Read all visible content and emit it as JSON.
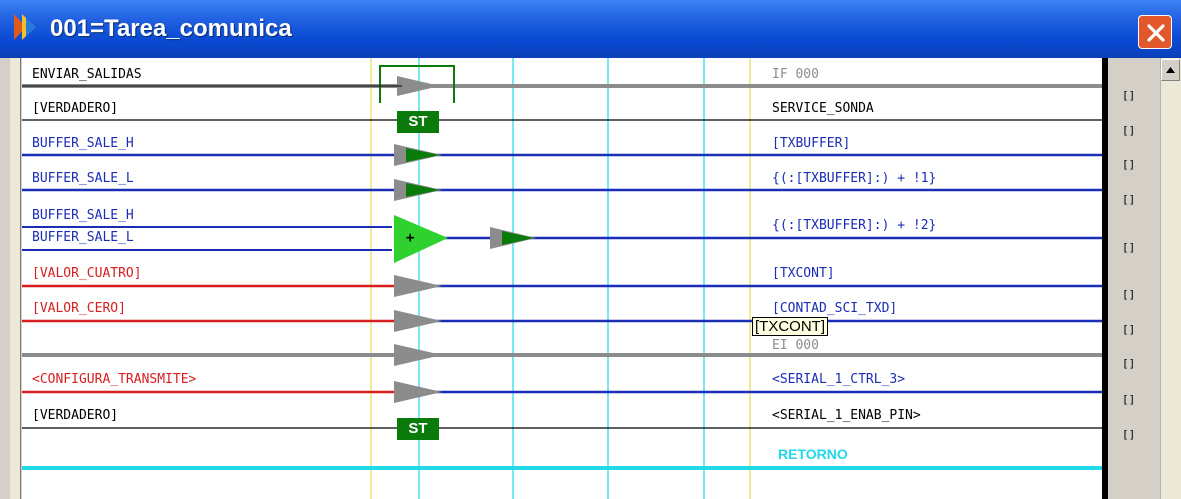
{
  "window": {
    "title": "001=Tarea_comunica"
  },
  "colors": {
    "blue_line": "#1a2db5",
    "red_line": "#d81e1e",
    "gray_line": "#8c8c8c",
    "cyan_line": "#22d9e8",
    "green_block": "#0a7a0a"
  },
  "rows": [
    {
      "left": "ENVIAR_SALIDAS",
      "right": "IF  000",
      "left_color": "#000000",
      "right_color": "#8c8c8c"
    },
    {
      "left": "[VERDADERO]",
      "right": "SERVICE_SONDA",
      "left_color": "#000000",
      "right_color": "#000000"
    },
    {
      "left": "BUFFER_SALE_H",
      "right": "[TXBUFFER]",
      "left_color": "#1a2db5",
      "right_color": "#1a2db5"
    },
    {
      "left": "BUFFER_SALE_L",
      "right": "{(:[TXBUFFER]:) + !1}",
      "left_color": "#1a2db5",
      "right_color": "#1a2db5"
    },
    {
      "left": "BUFFER_SALE_H",
      "right": "",
      "left_color": "#1a2db5",
      "right_color": "#1a2db5"
    },
    {
      "left": "BUFFER_SALE_L",
      "right": "{(:[TXBUFFER]:) + !2}",
      "left_color": "#1a2db5",
      "right_color": "#1a2db5"
    },
    {
      "left": "[VALOR_CUATRO]",
      "right": "[TXCONT]",
      "left_color": "#d81e1e",
      "right_color": "#1a2db5"
    },
    {
      "left": "[VALOR_CERO]",
      "right": "[CONTAD_SCI_TXD]",
      "left_color": "#d81e1e",
      "right_color": "#1a2db5"
    },
    {
      "left": "",
      "right": "EI  000",
      "left_color": "#000000",
      "right_color": "#8c8c8c"
    },
    {
      "left": "<CONFIGURA_TRANSMITE>",
      "right": "<SERIAL_1_CTRL_3>",
      "left_color": "#d81e1e",
      "right_color": "#1a2db5"
    },
    {
      "left": "[VERDADERO]",
      "right": "<SERIAL_1_ENAB_PIN>",
      "left_color": "#000000",
      "right_color": "#000000"
    }
  ],
  "st_label": "ST",
  "plus_label": "+",
  "tooltip": "[TXCONT]",
  "retorno": "RETORNO",
  "bracket_label": "[]"
}
